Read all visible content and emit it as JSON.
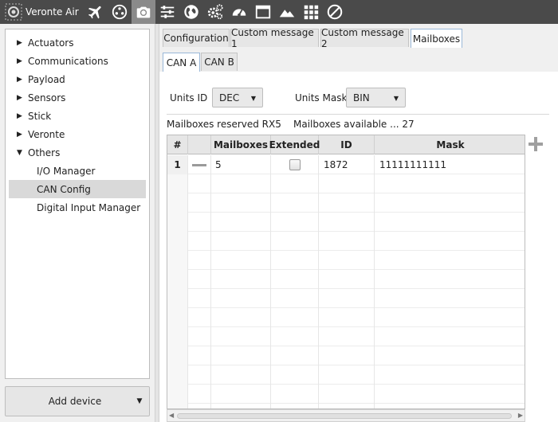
{
  "app": {
    "title": "Veronte Air"
  },
  "toolbar": {
    "icons": [
      "airplane-icon",
      "joystick-icon",
      "camera-icon",
      "sliders-icon",
      "globe-icon",
      "gears-icon",
      "gauge-icon",
      "window-icon",
      "terrain-icon",
      "grid-icon",
      "no-entry-icon"
    ],
    "active_icon": "camera-icon"
  },
  "sidebar": {
    "items": [
      {
        "label": "Actuators",
        "expanded": false
      },
      {
        "label": "Communications",
        "expanded": false
      },
      {
        "label": "Payload",
        "expanded": false
      },
      {
        "label": "Sensors",
        "expanded": false
      },
      {
        "label": "Stick",
        "expanded": false
      },
      {
        "label": "Veronte",
        "expanded": false
      },
      {
        "label": "Others",
        "expanded": true
      }
    ],
    "children": [
      {
        "label": "I/O Manager",
        "selected": false
      },
      {
        "label": "CAN Config",
        "selected": true
      },
      {
        "label": "Digital Input Manager",
        "selected": false
      }
    ],
    "add_device_label": "Add device"
  },
  "tabs": {
    "main": [
      "Configuration",
      "Custom message 1",
      "Custom message 2",
      "Mailboxes"
    ],
    "main_active": "Mailboxes",
    "sub": [
      "CAN A",
      "CAN B"
    ],
    "sub_active": "CAN A"
  },
  "units": {
    "id_label": "Units ID",
    "id_value": "DEC",
    "mask_label": "Units Mask",
    "mask_value": "BIN"
  },
  "info": {
    "reserved": "Mailboxes reserved RX5",
    "available": "Mailboxes available ... 27"
  },
  "table": {
    "columns": [
      "#",
      "",
      "Mailboxes",
      "Extended",
      "ID",
      "Mask"
    ],
    "rows": [
      {
        "num": "1",
        "mailboxes": "5",
        "extended": false,
        "id": "1872",
        "mask": "11111111111"
      }
    ]
  },
  "colors": {
    "toolbar_bg": "#4a4a4a",
    "active_tab_border": "#9ab8d8",
    "selected_item": "#d9d9d9"
  }
}
